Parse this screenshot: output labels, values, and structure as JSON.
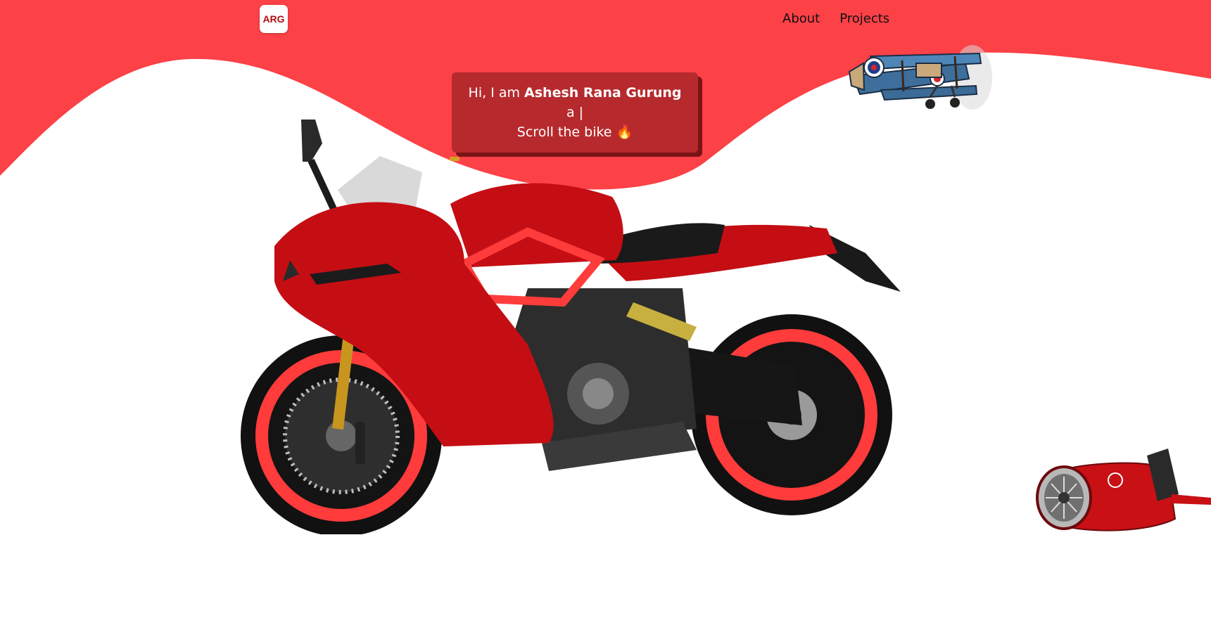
{
  "nav": {
    "logo": "ARG",
    "links": [
      "About",
      "Projects"
    ]
  },
  "intro": {
    "greeting": "Hi, I am",
    "name": "Ashesh Rana Gurung",
    "role_line": "a |",
    "cta": "Scroll the bike 🔥"
  },
  "colors": {
    "brand_red": "#fc4147",
    "card_bg": "#b62a2e",
    "bike_red": "#c40e14",
    "rim_red": "#ff3b3b"
  },
  "icons": {
    "plane": "biplane-illustration",
    "bike": "motorcycle-illustration",
    "engine": "jet-engine-illustration"
  }
}
